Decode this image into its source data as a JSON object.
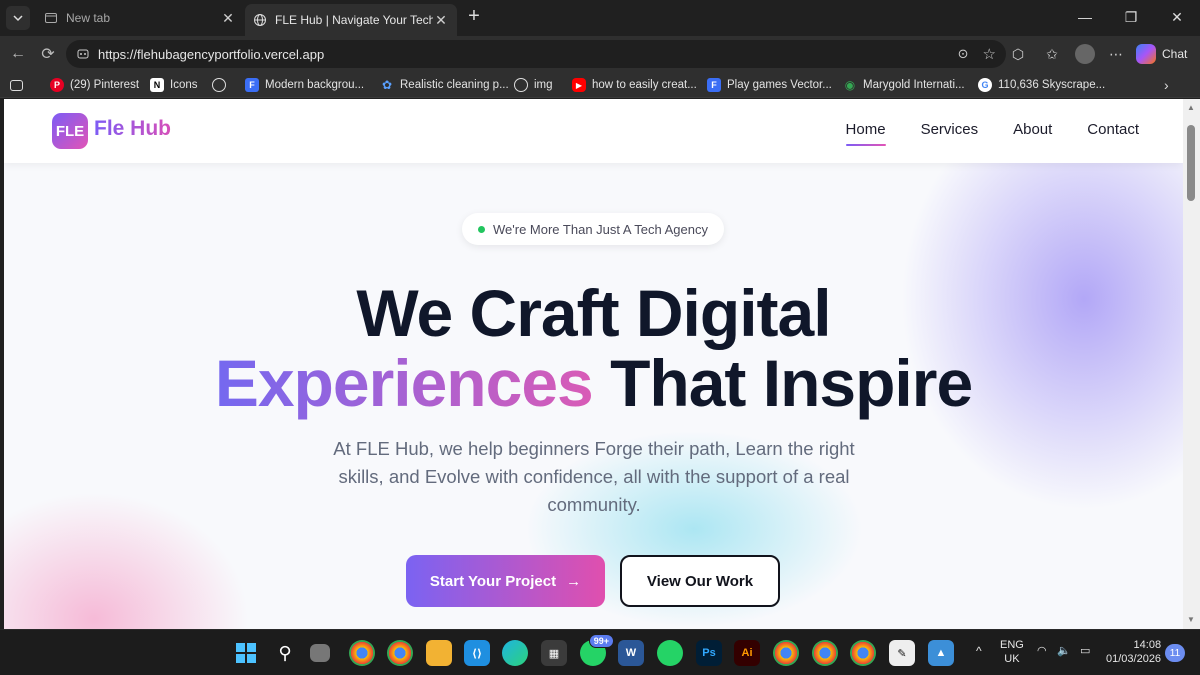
{
  "browser": {
    "tabs": [
      {
        "title": "New tab",
        "active": false
      },
      {
        "title": "FLE Hub | Navigate Your Tech Journ",
        "active": true
      }
    ],
    "url": "https://flehubagencyportfolio.vercel.app",
    "chat_label": "Chat",
    "bookmarks": [
      {
        "label": "(29) Pinterest"
      },
      {
        "label": "Icons"
      },
      {
        "label": ""
      },
      {
        "label": "Modern backgrou..."
      },
      {
        "label": "Realistic cleaning p..."
      },
      {
        "label": "img"
      },
      {
        "label": "how to easily creat..."
      },
      {
        "label": "Play games Vector..."
      },
      {
        "label": "Marygold Internati..."
      },
      {
        "label": "110,636 Skyscrape..."
      }
    ]
  },
  "site": {
    "logo_mark": "FLE",
    "logo_text": "Fle Hub",
    "nav": [
      {
        "label": "Home",
        "active": true
      },
      {
        "label": "Services",
        "active": false
      },
      {
        "label": "About",
        "active": false
      },
      {
        "label": "Contact",
        "active": false
      }
    ],
    "badge": "We're More Than Just A Tech Agency",
    "headline_line1": "We Craft Digital",
    "headline_highlight": "Experiences",
    "headline_line2_rest": "That Inspire",
    "subtitle": "At FLE Hub, we help beginners Forge their path, Learn the right skills, and Evolve with confidence, all with the support of a real community.",
    "primary_cta": "Start Your Project",
    "secondary_cta": "View Our Work"
  },
  "taskbar": {
    "whatsapp_badge": "99+",
    "lang_top": "ENG",
    "lang_bottom": "UK",
    "time": "14:08",
    "date": "01/03/2026",
    "notifications": "11"
  },
  "colors": {
    "accent_purple": "#7b63f2",
    "accent_pink": "#e04fae",
    "heading": "#10172a",
    "status_green": "#22c55e"
  }
}
